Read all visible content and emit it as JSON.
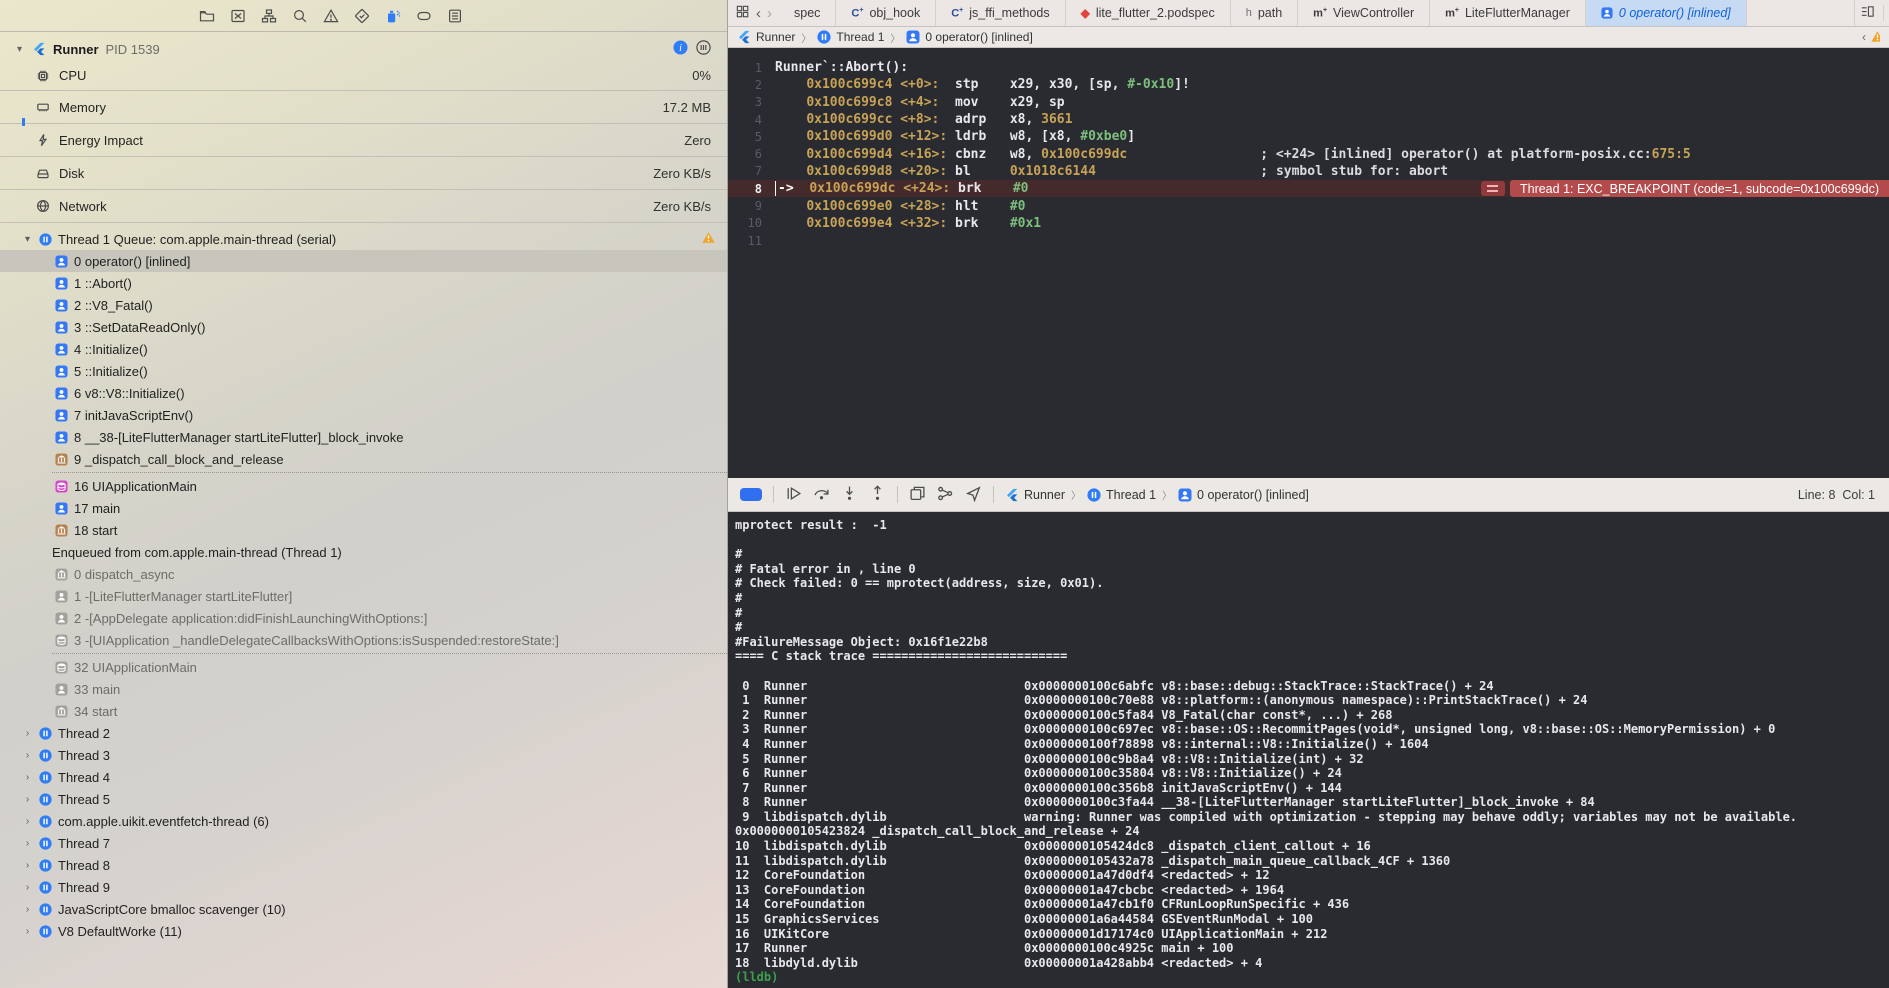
{
  "sidebar": {
    "toolbar_icons": [
      {
        "icon": "folder",
        "name": "project-navigator-icon"
      },
      {
        "icon": "xsquare",
        "name": "source-control-navigator-icon"
      },
      {
        "icon": "hierarchy",
        "name": "symbol-navigator-icon"
      },
      {
        "icon": "search",
        "name": "find-navigator-icon"
      },
      {
        "icon": "warntri",
        "name": "issue-navigator-icon"
      },
      {
        "icon": "diamond",
        "name": "test-navigator-icon"
      },
      {
        "icon": "spray",
        "name": "debug-navigator-icon",
        "active": true
      },
      {
        "icon": "capsule",
        "name": "breakpoint-navigator-icon"
      },
      {
        "icon": "list",
        "name": "report-navigator-icon"
      }
    ],
    "process": {
      "name": "Runner",
      "pid": "PID 1539"
    },
    "gauges": [
      {
        "icon": "cpu",
        "label": "CPU",
        "value": "0%"
      },
      {
        "icon": "memory",
        "label": "Memory",
        "value": "17.2 MB"
      },
      {
        "icon": "energy",
        "label": "Energy Impact",
        "value": "Zero"
      },
      {
        "icon": "disk",
        "label": "Disk",
        "value": "Zero KB/s"
      },
      {
        "icon": "network",
        "label": "Network",
        "value": "Zero KB/s"
      }
    ],
    "threads": [
      {
        "type": "thread",
        "label": "Thread 1 Queue: com.apple.main-thread (serial)",
        "expanded": true,
        "warning": true
      },
      {
        "type": "frame",
        "icon": "person_blue",
        "label": "0 operator() [inlined]",
        "selected": true
      },
      {
        "type": "frame",
        "icon": "person_blue",
        "label": "1 ::Abort()"
      },
      {
        "type": "frame",
        "icon": "person_blue",
        "label": "2 ::V8_Fatal()"
      },
      {
        "type": "frame",
        "icon": "person_blue",
        "label": "3 ::SetDataReadOnly()"
      },
      {
        "type": "frame",
        "icon": "person_blue",
        "label": "4 ::Initialize()"
      },
      {
        "type": "frame",
        "icon": "person_blue",
        "label": "5 ::Initialize()"
      },
      {
        "type": "frame",
        "icon": "person_blue",
        "label": "6 v8::V8::Initialize()"
      },
      {
        "type": "frame",
        "icon": "person_blue",
        "label": "7 initJavaScriptEnv()"
      },
      {
        "type": "frame",
        "icon": "person_blue",
        "label": "8 __38-[LiteFlutterManager startLiteFlutter]_block_invoke"
      },
      {
        "type": "frame",
        "icon": "bank_tan",
        "label": "9 _dispatch_call_block_and_release"
      },
      {
        "type": "dotsep"
      },
      {
        "type": "frame",
        "icon": "layers_pink",
        "label": "16 UIApplicationMain"
      },
      {
        "type": "frame",
        "icon": "person_blue",
        "label": "17 main"
      },
      {
        "type": "frame",
        "icon": "bank_tan",
        "label": "18 start"
      },
      {
        "type": "lbl",
        "label": "Enqueued from com.apple.main-thread (Thread 1)"
      },
      {
        "type": "frame",
        "icon": "bank_gray",
        "label": "0 dispatch_async",
        "dim": true
      },
      {
        "type": "frame",
        "icon": "person_gray",
        "label": "1 -[LiteFlutterManager startLiteFlutter]",
        "dim": true
      },
      {
        "type": "frame",
        "icon": "person_gray",
        "label": "2 -[AppDelegate application:didFinishLaunchingWithOptions:]",
        "dim": true
      },
      {
        "type": "frame",
        "icon": "layers_gray",
        "label": "3 -[UIApplication _handleDelegateCallbacksWithOptions:isSuspended:restoreState:]",
        "dim": true
      },
      {
        "type": "dotsep"
      },
      {
        "type": "frame",
        "icon": "layers_gray",
        "label": "32 UIApplicationMain",
        "dim": true
      },
      {
        "type": "frame",
        "icon": "person_gray",
        "label": "33 main",
        "dim": true
      },
      {
        "type": "frame",
        "icon": "bank_gray",
        "label": "34 start",
        "dim": true
      },
      {
        "type": "thread",
        "label": "Thread 2"
      },
      {
        "type": "thread",
        "label": "Thread 3"
      },
      {
        "type": "thread",
        "label": "Thread 4"
      },
      {
        "type": "thread",
        "label": "Thread 5"
      },
      {
        "type": "thread",
        "label": "com.apple.uikit.eventfetch-thread (6)"
      },
      {
        "type": "thread",
        "label": "Thread 7"
      },
      {
        "type": "thread",
        "label": "Thread 8"
      },
      {
        "type": "thread",
        "label": "Thread 9"
      },
      {
        "type": "thread",
        "label": "JavaScriptCore bmalloc scavenger (10)"
      },
      {
        "type": "thread",
        "label": "V8 DefaultWorke (11)"
      }
    ]
  },
  "editor": {
    "tabs": [
      {
        "icon": "",
        "label": "spec"
      },
      {
        "icon": "c",
        "label": "obj_hook"
      },
      {
        "icon": "c",
        "label": "js_ffi_methods"
      },
      {
        "icon": "gem",
        "label": "lite_flutter_2.podspec"
      },
      {
        "icon": "h",
        "label": "path"
      },
      {
        "icon": "m",
        "label": "ViewController"
      },
      {
        "icon": "m",
        "label": "LiteFlutterManager"
      },
      {
        "icon": "person",
        "label": "0 operator() [inlined]",
        "selected": true
      }
    ],
    "breadcrumb": [
      {
        "icon": "flutter",
        "label": "Runner"
      },
      {
        "icon": "pause",
        "label": "Thread 1"
      },
      {
        "icon": "person",
        "label": "0 operator() [inlined]"
      }
    ],
    "code_lines": [
      {
        "n": 1,
        "segs": [
          [
            "sym",
            "Runner`::Abort():"
          ]
        ]
      },
      {
        "n": 2,
        "segs": [
          [
            "sym",
            "    "
          ],
          [
            "addr",
            "0x100c699c4 <+0>:  "
          ],
          [
            "sym",
            "stp    x29, x30, [sp, "
          ],
          [
            "imm",
            "#-0x10"
          ],
          [
            "sym",
            "]!"
          ]
        ]
      },
      {
        "n": 3,
        "segs": [
          [
            "sym",
            "    "
          ],
          [
            "addr",
            "0x100c699c8 <+4>:  "
          ],
          [
            "sym",
            "mov    x29, sp"
          ]
        ]
      },
      {
        "n": 4,
        "segs": [
          [
            "sym",
            "    "
          ],
          [
            "addr",
            "0x100c699cc <+8>:  "
          ],
          [
            "sym",
            "adrp   x8, "
          ],
          [
            "num",
            "3661"
          ]
        ]
      },
      {
        "n": 5,
        "segs": [
          [
            "sym",
            "    "
          ],
          [
            "addr",
            "0x100c699d0 <+12>: "
          ],
          [
            "sym",
            "ldrb   w8, [x8, "
          ],
          [
            "imm",
            "#0xbe0"
          ],
          [
            "sym",
            "]"
          ]
        ]
      },
      {
        "n": 6,
        "segs": [
          [
            "sym",
            "    "
          ],
          [
            "addr",
            "0x100c699d4 <+16>: "
          ],
          [
            "sym",
            "cbnz   w8, "
          ],
          [
            "num",
            "0x100c699dc"
          ],
          [
            "sym",
            "                 "
          ],
          [
            "cmt",
            "; <+24> [inlined] operator() at platform-posix.cc:"
          ],
          [
            "num",
            "675:5"
          ]
        ]
      },
      {
        "n": 7,
        "segs": [
          [
            "sym",
            "    "
          ],
          [
            "addr",
            "0x100c699d8 <+20>: "
          ],
          [
            "sym",
            "bl     "
          ],
          [
            "num",
            "0x1018c6144"
          ],
          [
            "sym",
            "                     "
          ],
          [
            "cmt",
            "; symbol stub for: abort"
          ]
        ]
      },
      {
        "n": 8,
        "current": true,
        "segs": [
          [
            "arrow",
            "->"
          ],
          [
            "sym",
            "  "
          ],
          [
            "addr",
            "0x100c699dc <+24>: "
          ],
          [
            "sym",
            "brk    "
          ],
          [
            "imm",
            "#0"
          ]
        ]
      },
      {
        "n": 9,
        "segs": [
          [
            "sym",
            "    "
          ],
          [
            "addr",
            "0x100c699e0 <+28>: "
          ],
          [
            "sym",
            "hlt    "
          ],
          [
            "imm",
            "#0"
          ]
        ]
      },
      {
        "n": 10,
        "segs": [
          [
            "sym",
            "    "
          ],
          [
            "addr",
            "0x100c699e4 <+32>: "
          ],
          [
            "sym",
            "brk    "
          ],
          [
            "imm",
            "#0x1"
          ]
        ]
      },
      {
        "n": 11,
        "segs": []
      }
    ],
    "breakpoint_message": "Thread 1: EXC_BREAKPOINT (code=1, subcode=0x100c699dc)",
    "status": "Line: 8  Col: 1"
  },
  "console": {
    "lines": [
      "mprotect result :  -1",
      "",
      "#",
      "# Fatal error in , line 0",
      "# Check failed: 0 == mprotect(address, size, 0x01).",
      "#",
      "#",
      "#",
      "#FailureMessage Object: 0x16f1e22b8",
      "==== C stack trace ===========================",
      "",
      " 0  Runner                              0x0000000100c6abfc v8::base::debug::StackTrace::StackTrace() + 24",
      " 1  Runner                              0x0000000100c70e88 v8::platform::(anonymous namespace)::PrintStackTrace() + 24",
      " 2  Runner                              0x0000000100c5fa84 V8_Fatal(char const*, ...) + 268",
      " 3  Runner                              0x0000000100c697ec v8::base::OS::RecommitPages(void*, unsigned long, v8::base::OS::MemoryPermission) + 0",
      " 4  Runner                              0x0000000100f78898 v8::internal::V8::Initialize() + 1604",
      " 5  Runner                              0x0000000100c9b8a4 v8::V8::Initialize(int) + 32",
      " 6  Runner                              0x0000000100c35804 v8::V8::Initialize() + 24",
      " 7  Runner                              0x0000000100c356b8 initJavaScriptEnv() + 144",
      " 8  Runner                              0x0000000100c3fa44 __38-[LiteFlutterManager startLiteFlutter]_block_invoke + 84",
      " 9  libdispatch.dylib                   warning: Runner was compiled with optimization - stepping may behave oddly; variables may not be available.",
      "0x0000000105423824 _dispatch_call_block_and_release + 24",
      "10  libdispatch.dylib                   0x0000000105424dc8 _dispatch_client_callout + 16",
      "11  libdispatch.dylib                   0x0000000105432a78 _dispatch_main_queue_callback_4CF + 1360",
      "12  CoreFoundation                      0x00000001a47d0df4 <redacted> + 12",
      "13  CoreFoundation                      0x00000001a47cbcbc <redacted> + 1964",
      "14  CoreFoundation                      0x00000001a47cb1f0 CFRunLoopRunSpecific + 436",
      "15  GraphicsServices                    0x00000001a6a44584 GSEventRunModal + 100",
      "16  UIKitCore                           0x00000001d17174c0 UIApplicationMain + 212",
      "17  Runner                              0x0000000100c4925c main + 100",
      "18  libdyld.dylib                       0x00000001a428abb4 <redacted> + 4"
    ],
    "prompt": "(lldb) "
  }
}
